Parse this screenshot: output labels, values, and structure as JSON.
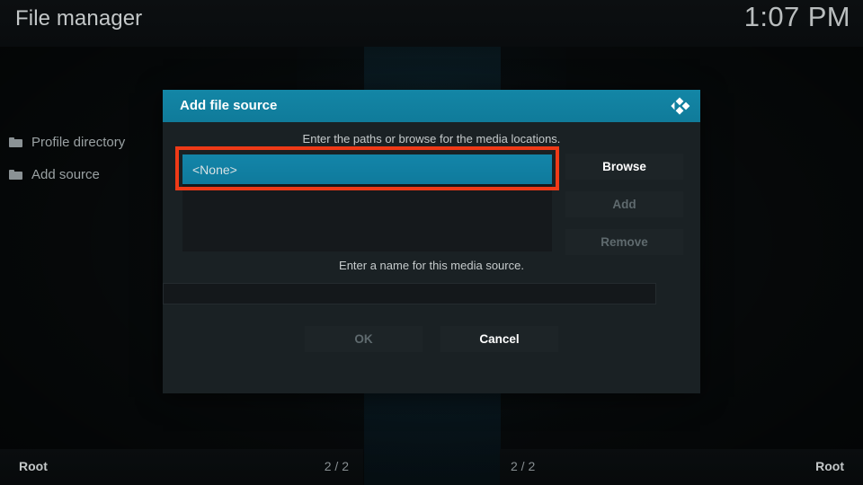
{
  "window": {
    "title": "File manager",
    "clock": "1:07 PM"
  },
  "filelist": {
    "items": [
      {
        "icon": "folder-icon",
        "label": "Profile directory"
      },
      {
        "icon": "folder-icon",
        "label": "Add source"
      }
    ]
  },
  "dialog": {
    "title": "Add file source",
    "logo_icon": "kodi-logo-icon",
    "hint_paths": "Enter the paths or browse for the media locations.",
    "path_list": {
      "selected_value": "<None>",
      "rows": [
        "<None>"
      ]
    },
    "side_buttons": [
      {
        "label": "Browse",
        "disabled": false
      },
      {
        "label": "Add",
        "disabled": true
      },
      {
        "label": "Remove",
        "disabled": true
      }
    ],
    "hint_name": "Enter a name for this media source.",
    "name_input": {
      "value": "",
      "placeholder": ""
    },
    "footer_buttons": [
      {
        "label": "OK",
        "disabled": true
      },
      {
        "label": "Cancel",
        "disabled": false
      }
    ]
  },
  "statusbar": {
    "left": {
      "root": "Root",
      "count": "2 / 2"
    },
    "right": {
      "count": "2 / 2",
      "root": "Root"
    }
  },
  "colors": {
    "accent": "#1180a4",
    "header": "#12809f",
    "annotation": "#ef3a17",
    "dialog_bg": "#1a2124",
    "page_bg": "#070a0b",
    "text_primary": "#c3c7c8",
    "text_disabled": "#5f6a6e"
  }
}
